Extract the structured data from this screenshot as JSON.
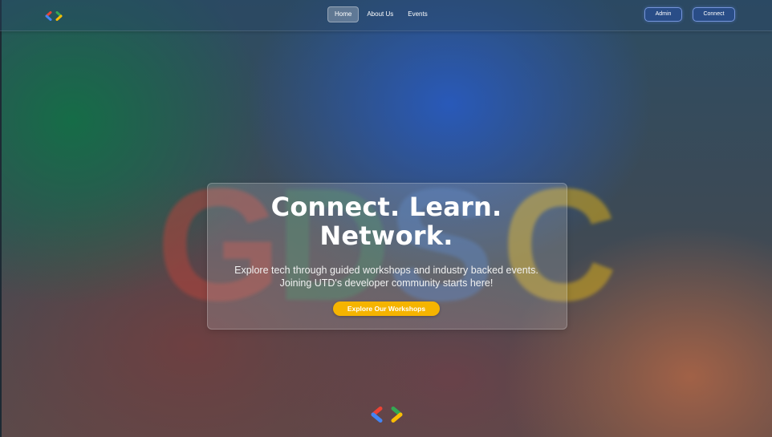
{
  "navbar": {
    "links": [
      {
        "label": "Home",
        "active": true
      },
      {
        "label": "About Us",
        "active": false
      },
      {
        "label": "Events",
        "active": false
      }
    ],
    "admin_label": "Admin",
    "connect_label": "Connect"
  },
  "hero": {
    "watermark": "GDSC",
    "title_line1": "Connect. Learn.",
    "title_line2": "Network.",
    "subtitle_line1": "Explore tech through guided workshops and industry backed events.",
    "subtitle_line2": "Joining UTD's developer community starts here!",
    "cta_label": "Explore Our Workshops"
  },
  "icons": {
    "header_logo": "gdsc-logo-icon",
    "footer_logo": "gdsc-logo-icon"
  },
  "colors": {
    "cta": "#f5b400",
    "google_blue": "#4285f4",
    "google_red": "#ea4335",
    "google_yellow": "#fbbc04",
    "google_green": "#34a853"
  }
}
